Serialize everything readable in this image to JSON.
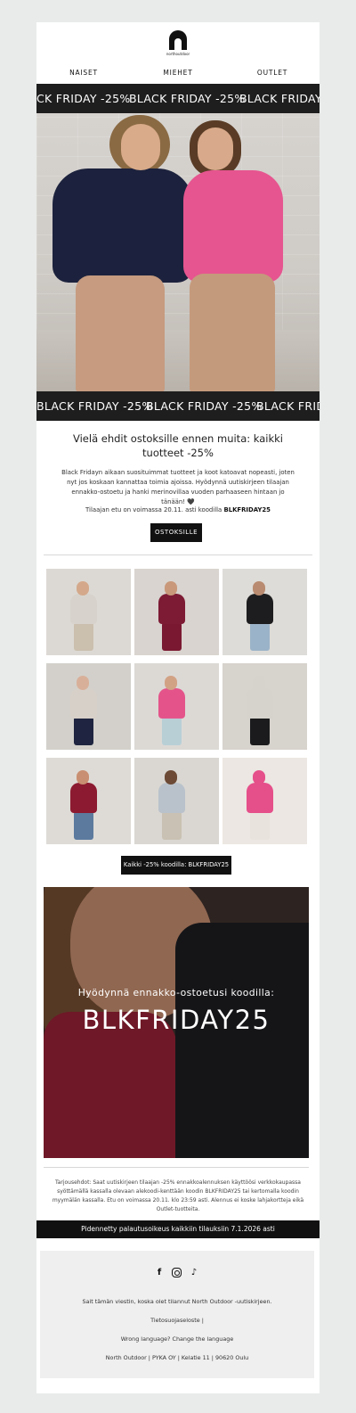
{
  "brand": {
    "logo_text": "northoutdoor"
  },
  "nav": {
    "items": [
      "NAISET",
      "MIEHET",
      "OUTLET"
    ]
  },
  "marquee": {
    "top": [
      "CK FRIDAY -25%",
      "BLACK FRIDAY -25%",
      "BLACK FRIDAY -25%"
    ],
    "bottom": [
      "BLACK FRIDAY -25%",
      "BLACK FRIDAY -25%",
      "BLACK FRID"
    ]
  },
  "intro": {
    "headline": "Vielä ehdit ostoksille ennen muita: kaikki tuotteet -25%",
    "body": "Black Fridayn aikaan suosituimmat tuotteet ja koot katoavat nopeasti, joten nyt jos koskaan kannattaa toimia ajoissa. Hyödynnä uutiskirjeen tilaajan ennakko-ostoetu ja hanki merinovillaa vuoden parhaaseen hintaan jo tänään! 🖤",
    "coupon_prefix": "Tilaajan etu on voimassa 20.11. asti koodilla ",
    "coupon_code": "BLKFRIDAY25",
    "cta_label": "OSTOKSILLE"
  },
  "products": [
    {
      "bg": "#dcd9d4",
      "head": "#d4a98b",
      "top": "#d7d3cc",
      "legs": "#cbbfae"
    },
    {
      "bg": "#d9d4cf",
      "head": "#c9987a",
      "top": "#7d1a34",
      "legs": "#7a1832"
    },
    {
      "bg": "#dedcd8",
      "head": "#b98b70",
      "top": "#1d1d1f",
      "legs": "#9bb3c8"
    },
    {
      "bg": "#d3d0cb",
      "head": "#d8b09a",
      "top": "#d7d0c8",
      "legs": "#1f2540"
    },
    {
      "bg": "#dcd9d5",
      "head": "#d2a285",
      "top": "#e4548a",
      "legs": "#b8cfd6"
    },
    {
      "bg": "#d7d3cd",
      "head": "#d6d3cd",
      "top": "#d6d3cd",
      "legs": "#1b1b1d"
    },
    {
      "bg": "#dedbd6",
      "head": "#c98f72",
      "top": "#8c1a30",
      "legs": "#5c7a9e"
    },
    {
      "bg": "#dad7d2",
      "head": "#6c4a35",
      "top": "#b9c2cb",
      "legs": "#c9c1b3"
    },
    {
      "bg": "#ece7e2",
      "head": "#e54f8a",
      "top": "#e54f8a",
      "legs": "#e8e3dc"
    }
  ],
  "all_products_cta": "Kaikki -25% koodilla: BLKFRIDAY25",
  "promo": {
    "subtitle": "Hyödynnä ennakko-ostoetusi koodilla:",
    "code": "BLKFRIDAY25"
  },
  "terms": "Tarjousehdot: Saat uutiskirjeen tilaajan -25% ennakkoalennuksen käyttöösi verkkokaupassa syöttämällä kassalla olevaan alekoodi-kenttään koodin BLKFRIDAY25 tai kertomalla koodin myymälän kassalla. Etu on voimassa 20.11. klo 23:59 asti. Alennus ei koske lahjakortteja eikä Outlet-tuotteita.",
  "return_policy": "Pidennetty palautusoikeus kaikkiin tilauksiin 7.1.2026 asti",
  "footer": {
    "social": [
      "facebook-icon",
      "instagram-icon",
      "tiktok-icon"
    ],
    "notice": "Sait tämän viestin, koska olet tilannut North Outdoor -uutiskirjeen.",
    "privacy": "Tietosuojaseloste |",
    "language": "Wrong language? Change the language",
    "address": "North Outdoor | PYKA OY | Kelatie 11 | 90620 Oulu"
  }
}
